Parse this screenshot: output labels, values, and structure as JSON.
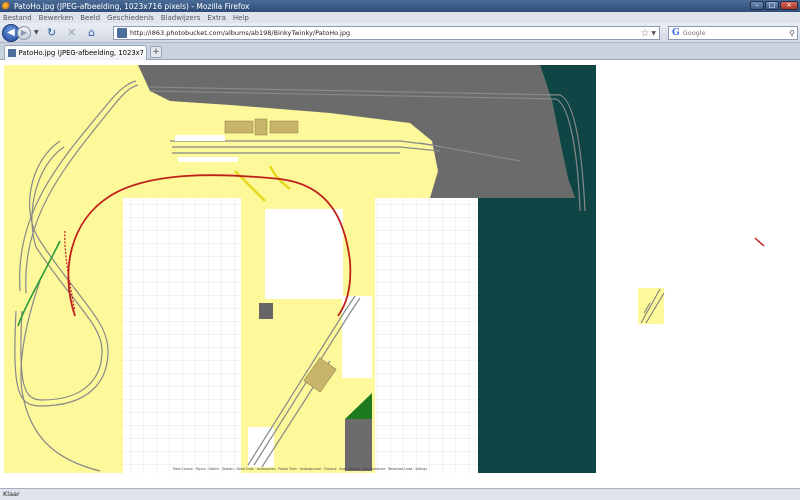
{
  "window": {
    "title": "PatoHo.jpg (JPEG-afbeelding, 1023x716 pixels) - Mozilla Firefox"
  },
  "menu": {
    "items": [
      "Bestand",
      "Bewerken",
      "Beeld",
      "Geschiedenis",
      "Bladwijzers",
      "Extra",
      "Help"
    ]
  },
  "navigation": {
    "url": "http://i863.photobucket.com/albums/ab198/BinkyTwinky/PatoHo.jpg",
    "search_placeholder": "Google"
  },
  "tabs": [
    {
      "label": "PatoHo.jpg (JPEG-afbeelding, 1023x7..."
    }
  ],
  "image": {
    "legend": "Main Course · Figure · Switch · Station · Dead Ends · Accessories · Power Train · Underground · Chicane · Auto Module · Deadentrance · Reserved Lines · Sidings"
  },
  "status": {
    "text": "Klaar"
  },
  "colors": {
    "yellow_area": "#fdf89a",
    "dark_area": "#6b6b6b",
    "water": "#0f4545",
    "red_route": "#c0201a",
    "green_route": "#2a9b3a"
  }
}
